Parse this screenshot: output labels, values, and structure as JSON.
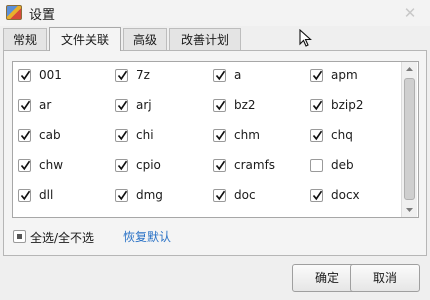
{
  "window": {
    "title": "设置",
    "close_glyph": "✕"
  },
  "tabs": [
    {
      "label": "常规",
      "active": false
    },
    {
      "label": "文件关联",
      "active": true
    },
    {
      "label": "高级",
      "active": false
    },
    {
      "label": "改善计划",
      "active": false
    }
  ],
  "file_types": [
    {
      "label": "001",
      "checked": true
    },
    {
      "label": "7z",
      "checked": true
    },
    {
      "label": "a",
      "checked": true
    },
    {
      "label": "apm",
      "checked": true
    },
    {
      "label": "ar",
      "checked": true
    },
    {
      "label": "arj",
      "checked": true
    },
    {
      "label": "bz2",
      "checked": true
    },
    {
      "label": "bzip2",
      "checked": true
    },
    {
      "label": "cab",
      "checked": true
    },
    {
      "label": "chi",
      "checked": true
    },
    {
      "label": "chm",
      "checked": true
    },
    {
      "label": "chq",
      "checked": true
    },
    {
      "label": "chw",
      "checked": true
    },
    {
      "label": "cpio",
      "checked": true
    },
    {
      "label": "cramfs",
      "checked": true
    },
    {
      "label": "deb",
      "checked": false
    },
    {
      "label": "dll",
      "checked": true
    },
    {
      "label": "dmg",
      "checked": true
    },
    {
      "label": "doc",
      "checked": true
    },
    {
      "label": "docx",
      "checked": true
    }
  ],
  "select_all": {
    "label": "全选/全不选",
    "state": "partial"
  },
  "restore_defaults": {
    "label": "恢复默认"
  },
  "buttons": {
    "ok": "确定",
    "cancel": "取消"
  },
  "icons": {
    "app": "app-icon",
    "close": "close-icon",
    "checkmark": "checkmark-icon",
    "cursor": "mouse-cursor-icon"
  }
}
